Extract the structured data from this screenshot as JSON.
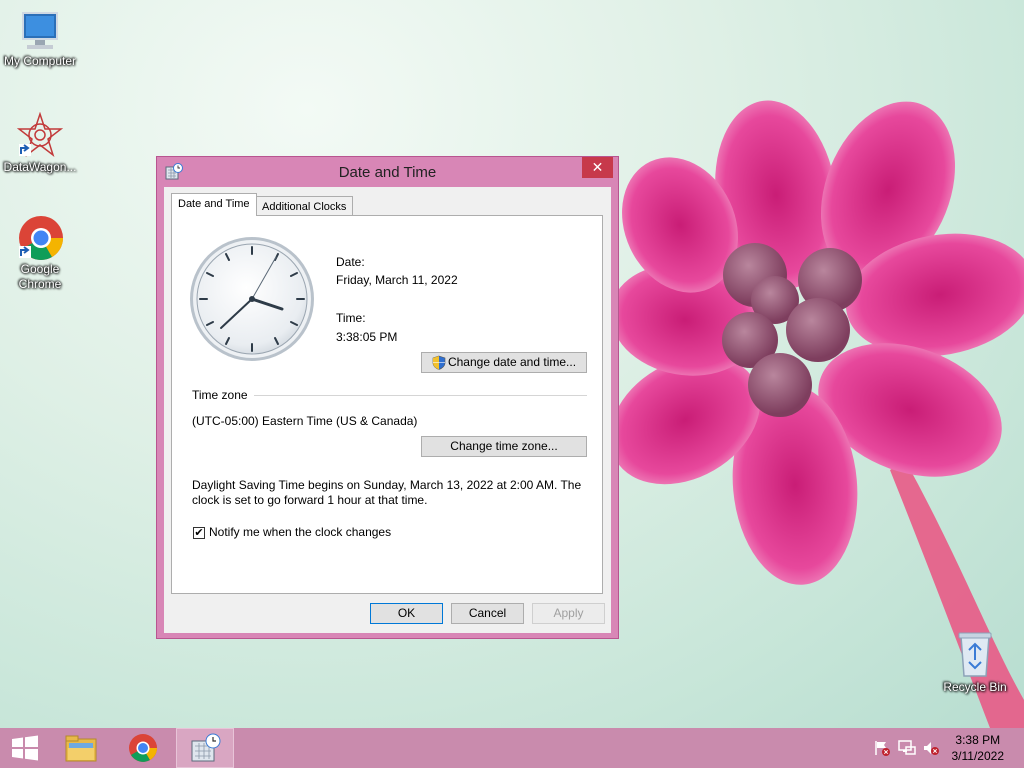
{
  "desktop": {
    "icons": [
      {
        "label": "My Computer",
        "icon": "computer-icon"
      },
      {
        "label": "DataWagon...",
        "icon": "datawagon-icon"
      },
      {
        "label": "Google Chrome",
        "icon": "chrome-icon"
      },
      {
        "label": "Recycle Bin",
        "icon": "recycle-bin-icon"
      }
    ],
    "wallpaper_accent": "#e0388e"
  },
  "dialog": {
    "title": "Date and Time",
    "close": "✕",
    "tabs": [
      {
        "label": "Date and Time",
        "active": true
      },
      {
        "label": "Additional Clocks",
        "active": false
      }
    ],
    "date_label": "Date:",
    "date_value": "Friday, March 11, 2022",
    "time_label": "Time:",
    "time_value": "3:38:05 PM",
    "change_datetime_button": "Change date and time...",
    "timezone_heading": "Time zone",
    "timezone_value": "(UTC-05:00) Eastern Time (US & Canada)",
    "change_timezone_button": "Change time zone...",
    "dst_line1": "Daylight Saving Time begins on Sunday, March 13, 2022 at 2:00 AM. The",
    "dst_line2": "clock is set to go forward 1 hour at that time.",
    "notify_label": "Notify me when the clock changes",
    "notify_checked": true,
    "ok_button": "OK",
    "cancel_button": "Cancel",
    "apply_button": "Apply"
  },
  "taskbar": {
    "items": [
      "start-icon",
      "file-explorer-icon",
      "chrome-icon",
      "date-time-app-icon"
    ],
    "tray_icons": [
      "action-center-flag-icon",
      "network-icon",
      "volume-muted-icon"
    ],
    "clock_time": "3:38 PM",
    "clock_date": "3/11/2022",
    "color": "#c98bad"
  }
}
